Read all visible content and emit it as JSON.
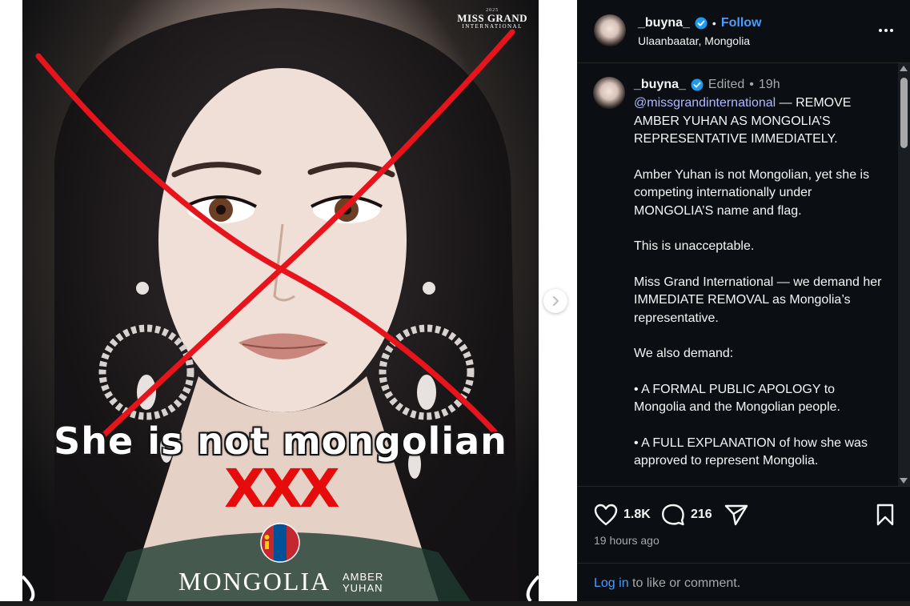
{
  "post_image": {
    "brand_small": "2025",
    "brand_main": "MISS GRAND",
    "brand_sub": "INTERNATIONAL",
    "overlay_caption": "She is not mongolian",
    "x_marks": "XXX",
    "country": "MONGOLIA",
    "contestant_first": "AMBER",
    "contestant_last": "YUHAN",
    "cross_color": "#e8141c"
  },
  "header": {
    "username": "_buyna_",
    "follow_label": "Follow",
    "separator": "•",
    "location": "Ulaanbaatar, Mongolia"
  },
  "caption": {
    "username": "_buyna_",
    "edited": "Edited",
    "separator": "•",
    "time": "19h",
    "mention": "@missgrandinternational",
    "first_line_rest": " — REMOVE AMBER YUHAN AS MONGOLIA’S REPRESENTATIVE IMMEDIATELY.",
    "paragraphs": [
      "Amber Yuhan is not Mongolian, yet she is competing internationally under MONGOLIA’S name and flag.",
      "This is unacceptable.",
      "Miss Grand International — we demand her IMMEDIATE REMOVAL as Mongolia’s representative.",
      "We also demand:",
      "• A FORMAL PUBLIC APOLOGY to Mongolia and the Mongolian people.",
      "• A FULL EXPLANATION of how she was approved to represent Mongolia."
    ]
  },
  "actions": {
    "likes": "1.8K",
    "comments": "216",
    "posted_time": "19 hours ago"
  },
  "login": {
    "link": "Log in",
    "rest": " to like or comment."
  },
  "colors": {
    "panel_bg": "#0b0f14",
    "accent_blue": "#4a9dff",
    "verified_blue": "#1d9bf0",
    "mention": "#b0b8ff"
  },
  "icons": {
    "more": "more-options-icon",
    "next": "chevron-right-icon",
    "like": "heart-icon",
    "comment": "comment-bubble-icon",
    "share": "send-icon",
    "save": "bookmark-icon",
    "verified": "verified-badge-icon"
  }
}
